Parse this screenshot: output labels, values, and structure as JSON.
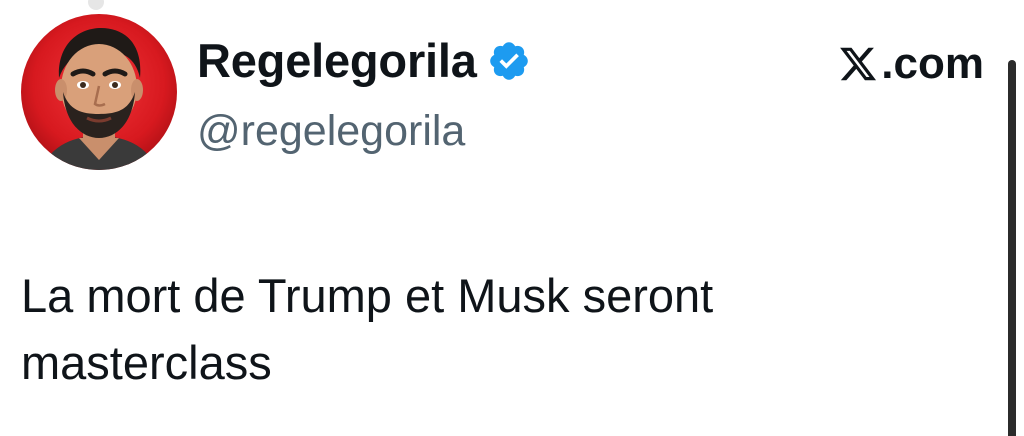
{
  "tweet": {
    "author": {
      "display_name": "Regelegorila",
      "handle": "@regelegorila",
      "verified": true,
      "verified_color": "#1d9bf0",
      "avatar_icon": "cartoon-bearded-man-avatar",
      "avatar_bg_color": "#d7191f"
    },
    "source": {
      "icon": "x-logo-icon",
      "label": ".com"
    },
    "text_lines": [
      "La mort de Trump et Musk seront",
      "masterclass"
    ]
  },
  "colors": {
    "text_primary": "#0f1419",
    "text_secondary": "#536471",
    "background": "#ffffff"
  }
}
